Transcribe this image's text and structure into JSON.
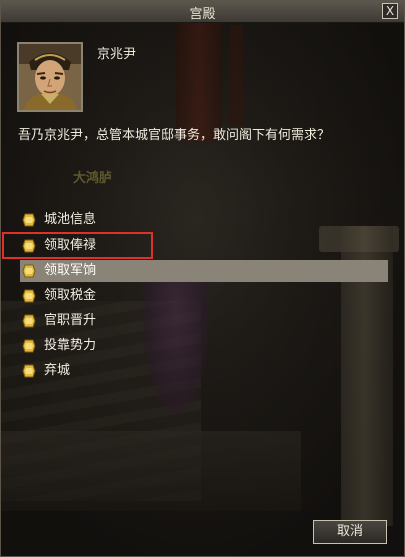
{
  "window": {
    "title": "宫殿",
    "close_label": "X"
  },
  "npc": {
    "name": "京兆尹",
    "dialog": "吾乃京兆尹，总管本城官邸事务，敢问阁下有何需求？",
    "location_label": "大鸿胪"
  },
  "options": [
    {
      "label": "城池信息",
      "icon": "gold-ingot-icon"
    },
    {
      "label": "领取俸禄",
      "icon": "gold-ingot-icon",
      "outlined": true
    },
    {
      "label": "领取军饷",
      "icon": "gold-ingot-icon",
      "highlighted": true
    },
    {
      "label": "领取税金",
      "icon": "gold-ingot-icon"
    },
    {
      "label": "官职晋升",
      "icon": "gold-ingot-icon"
    },
    {
      "label": "投靠势力",
      "icon": "gold-ingot-icon"
    },
    {
      "label": "弃城",
      "icon": "gold-ingot-icon"
    }
  ],
  "footer": {
    "cancel_label": "取消"
  },
  "colors": {
    "highlight_row": "#8a8377",
    "annotation_box": "#e0302a",
    "icon_gold": "#e2b93a"
  }
}
